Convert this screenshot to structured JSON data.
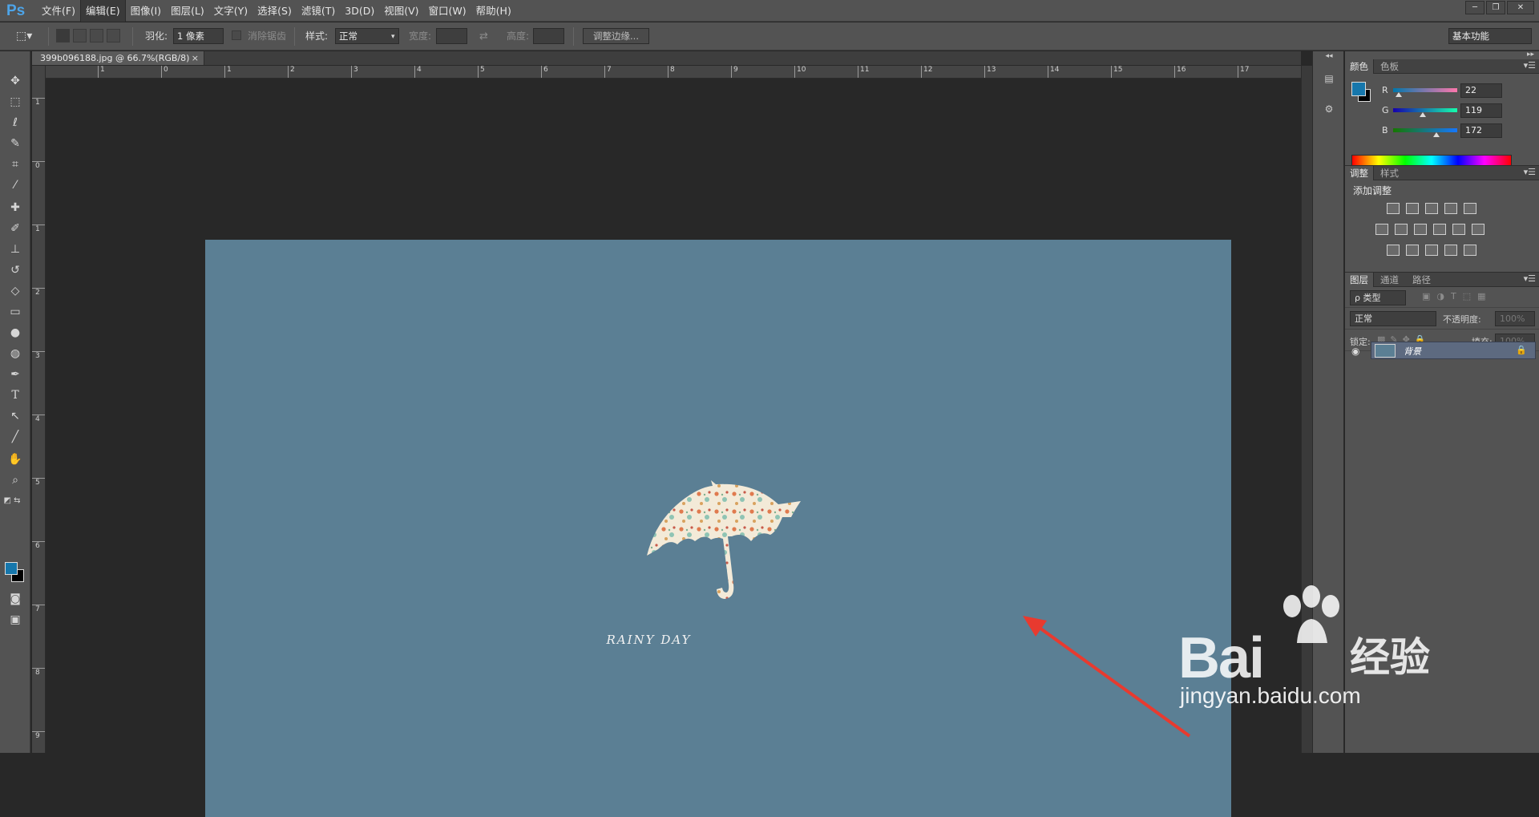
{
  "app": {
    "logo": "Ps"
  },
  "menu": [
    "文件(F)",
    "编辑(E)",
    "图像(I)",
    "图层(L)",
    "文字(Y)",
    "选择(S)",
    "滤镜(T)",
    "3D(D)",
    "视图(V)",
    "窗口(W)",
    "帮助(H)"
  ],
  "active_menu": "编辑(E)",
  "window_controls": {
    "minimize": "─",
    "restore": "❐",
    "close": "✕"
  },
  "options": {
    "feather_label": "羽化:",
    "feather_value": "1 像素",
    "antialias_label": "消除锯齿",
    "style_label": "样式:",
    "style_value": "正常",
    "width_label": "宽度:",
    "height_label": "高度:",
    "refine_edge": "调整边缘...",
    "workspace_value": "基本功能"
  },
  "document": {
    "tab_title": "399b096188.jpg @ 66.7%(RGB/8)",
    "close": "×",
    "caption": "RAINY DAY",
    "canvas_color": "#5b7f94"
  },
  "rulers": {
    "horizontal": [
      "1",
      "0",
      "1",
      "2",
      "3",
      "4",
      "5",
      "6",
      "7",
      "8",
      "9",
      "10",
      "11",
      "12",
      "13",
      "14",
      "15",
      "16",
      "17"
    ],
    "vertical": [
      "1",
      "0",
      "1",
      "2",
      "3",
      "4",
      "5",
      "6",
      "7",
      "8",
      "9"
    ]
  },
  "color_panel": {
    "tabs": [
      "颜色",
      "色板"
    ],
    "channels": [
      {
        "label": "R",
        "value": "22",
        "fraction": 0.086
      },
      {
        "label": "G",
        "value": "119",
        "fraction": 0.467
      },
      {
        "label": "B",
        "value": "172",
        "fraction": 0.675
      }
    ],
    "foreground": "#1677ac",
    "background": "#000000"
  },
  "adjust_panel": {
    "tabs": [
      "调整",
      "样式"
    ],
    "title": "添加调整"
  },
  "layers_panel": {
    "tabs": [
      "图层",
      "通道",
      "路径"
    ],
    "filter_label": "ρ 类型",
    "blend_mode": "正常",
    "opacity_label": "不透明度:",
    "opacity_value": "100%",
    "lock_label": "锁定:",
    "fill_label": "填充:",
    "fill_value": "100%",
    "layers": [
      {
        "name": "背景"
      }
    ]
  },
  "watermark": {
    "brand": "Bai",
    "brand_cn": "经验",
    "url": "jingyan.baidu.com"
  }
}
